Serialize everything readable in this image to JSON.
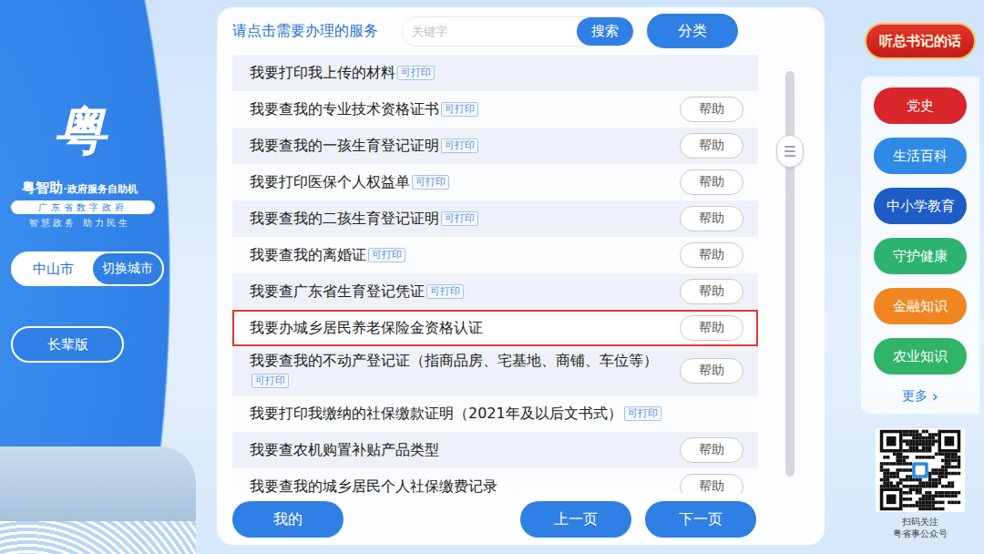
{
  "brand": {
    "logo": "粤",
    "title": "粤智助",
    "subtitle": "·政府服务自助机",
    "tagline": "广东省数字政府",
    "slogan": "智慧政务 助力民生"
  },
  "city": {
    "name": "中山市",
    "switch": "切换城市"
  },
  "elder_mode": "长辈版",
  "header": {
    "prompt": "请点击需要办理的服务",
    "search_placeholder": "关键字",
    "search_button": "搜索",
    "category_button": "分类"
  },
  "help_label": "帮助",
  "services": [
    {
      "label": "我要打印我上传的材料",
      "badge": "可打印",
      "help": false,
      "selected": false
    },
    {
      "label": "我要查我的专业技术资格证书",
      "badge": "可打印",
      "help": true,
      "selected": false
    },
    {
      "label": "我要查我的一孩生育登记证明",
      "badge": "可打印",
      "help": true,
      "selected": false
    },
    {
      "label": "我要打印医保个人权益单",
      "badge": "可打印",
      "help": true,
      "selected": false
    },
    {
      "label": "我要查我的二孩生育登记证明",
      "badge": "可打印",
      "help": true,
      "selected": false
    },
    {
      "label": "我要查我的离婚证",
      "badge": "可打印",
      "help": true,
      "selected": false
    },
    {
      "label": "我要查广东省生育登记凭证",
      "badge": "可打印",
      "help": true,
      "selected": false
    },
    {
      "label": "我要办城乡居民养老保险金资格认证",
      "badge": "",
      "help": true,
      "selected": true
    },
    {
      "label": "我要查我的不动产登记证（指商品房、宅基地、商铺、车位等）",
      "badge": "可打印",
      "help": true,
      "selected": false
    },
    {
      "label": "我要打印我缴纳的社保缴款证明（2021年及以后文书式）",
      "badge": "可打印",
      "help": false,
      "selected": false
    },
    {
      "label": "我要查农机购置补贴产品类型",
      "badge": "",
      "help": true,
      "selected": false
    },
    {
      "label": "我要查我的城乡居民个人社保缴费记录",
      "badge": "",
      "help": true,
      "selected": false
    }
  ],
  "scrollbar": {
    "position": 0.17
  },
  "footer": {
    "mine": "我的",
    "prev": "上一页",
    "next": "下一页"
  },
  "top_button": "听总书记的话",
  "topics": [
    {
      "label": "党史",
      "color": "#d8262b"
    },
    {
      "label": "生活百科",
      "color": "#2f8ae6"
    },
    {
      "label": "中小学教育",
      "color": "#1d5cc4"
    },
    {
      "label": "守护健康",
      "color": "#2bb36f"
    },
    {
      "label": "金融知识",
      "color": "#f08622"
    },
    {
      "label": "农业知识",
      "color": "#2fb468"
    }
  ],
  "more": {
    "label": "更多",
    "icon": "›"
  },
  "qr": {
    "caption": [
      "扫码关注",
      "粤省事公众号"
    ]
  }
}
